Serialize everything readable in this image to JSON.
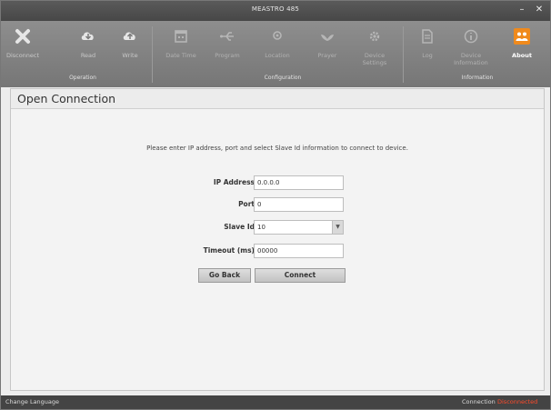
{
  "window": {
    "title": "MEASTRO 485",
    "minimize_label": "–",
    "close_label": "✕"
  },
  "ribbon": {
    "groups": {
      "operation": "Operation",
      "configuration": "Configuration",
      "information": "Information"
    },
    "buttons": {
      "disconnect": "Disconnect",
      "read": "Read",
      "write": "Write",
      "datetime": "Date Time",
      "program": "Program",
      "location": "Location",
      "prayer": "Prayer",
      "device_settings": "Device Settings",
      "log": "Log",
      "device_information": "Device Information",
      "about": "About"
    },
    "colors": {
      "accent": "#f08a1c"
    }
  },
  "panel": {
    "title": "Open Connection",
    "instruction": "Please enter IP address, port and select Slave Id information to connect to device.",
    "fields": {
      "ip": {
        "label": "IP Address",
        "value": "0.0.0.0"
      },
      "port": {
        "label": "Port",
        "value": "0"
      },
      "slave": {
        "label": "Slave Id",
        "value": "10"
      },
      "timeout": {
        "label": "Timeout (ms)",
        "value": "00000"
      }
    },
    "buttons": {
      "back": "Go Back",
      "connect": "Connect"
    }
  },
  "status": {
    "language": "Change Language",
    "connection_label": "Connection",
    "connection_value": "Disconnected"
  }
}
